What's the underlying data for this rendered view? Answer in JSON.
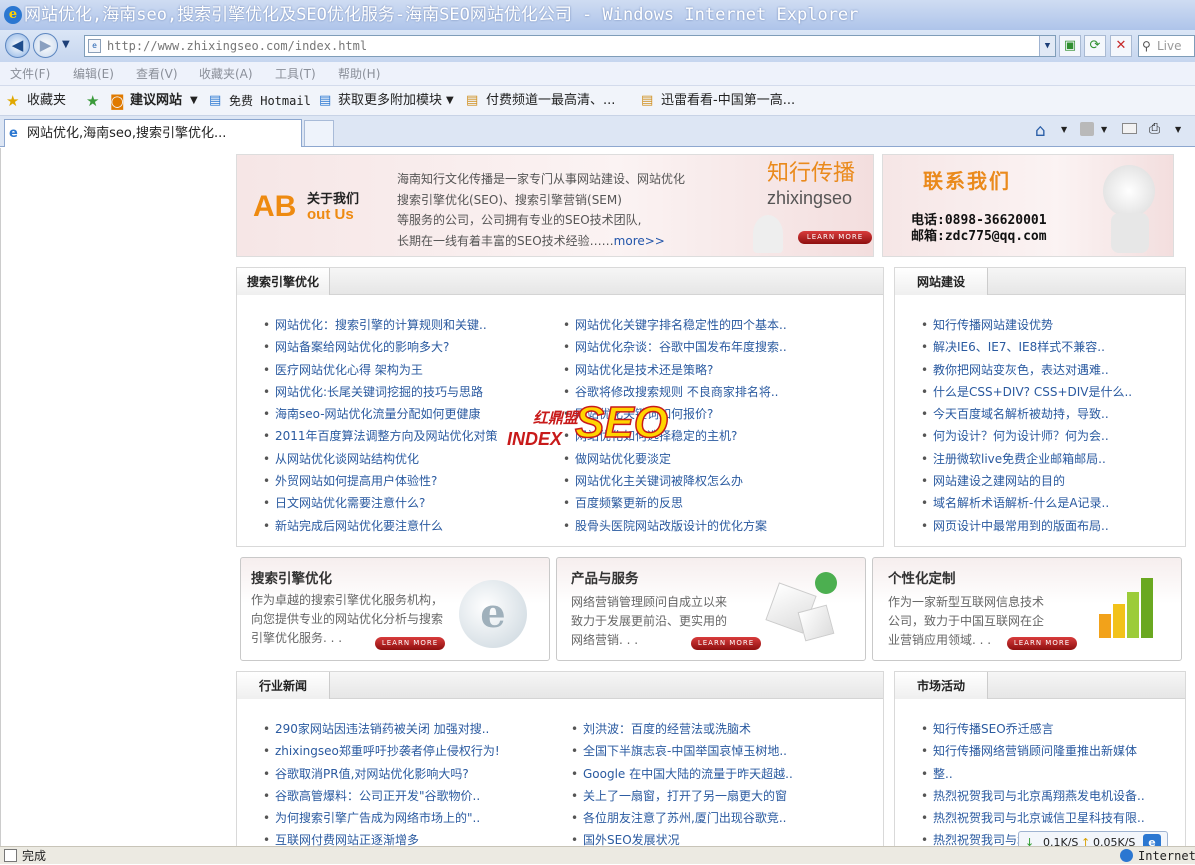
{
  "window": {
    "title": "网站优化,海南seo,搜索引擎优化及SEO优化服务-海南SEO网站优化公司 - Windows Internet Explorer"
  },
  "address": {
    "url": "http://www.zhixingseo.com/index.html",
    "search_placeholder": "Live"
  },
  "menu": {
    "items": [
      "文件(F)",
      "编辑(E)",
      "查看(V)",
      "收藏夹(A)",
      "工具(T)",
      "帮助(H)"
    ]
  },
  "favorites": {
    "label": "收藏夹",
    "items": [
      "建议网站",
      "免费 Hotmail",
      "获取更多附加模块",
      "付费频道一最高清、...",
      "迅雷看看-中国第一高..."
    ]
  },
  "tab": {
    "title": "网站优化,海南seo,搜索引擎优化..."
  },
  "about": {
    "badge_top": "关于我们",
    "badge_ab": "AB",
    "badge_out": "out Us",
    "text": [
      "海南知行文化传播是一家专门从事网站建设、网站优化",
      "搜索引擎优化(SEO)、搜索引擎营销(SEM)",
      "等服务的公司，公司拥有专业的SEO技术团队,",
      "长期在一线有着丰富的SEO技术经验……"
    ],
    "more": "more>>",
    "brand_cn": "知行传播",
    "brand_en": "zhixingseo",
    "learn": "LEARN MORE"
  },
  "contact": {
    "title": "联系我们",
    "phone": "电话:0898-36620001",
    "email": "邮箱:zdc775@qq.com"
  },
  "seo_panel": {
    "title": "搜索引擎优化",
    "left": [
      "网站优化：搜索引擎的计算规则和关键..",
      "网站备案给网站优化的影响多大?",
      "医疗网站优化心得 架构为王",
      "网站优化:长尾关键词挖掘的技巧与思路",
      "海南seo-网站优化流量分配如何更健康",
      "2011年百度算法调整方向及网站优化对策",
      "从网站优化谈网站结构优化",
      "外贸网站如何提高用户体验性?",
      "日文网站优化需要注意什么?",
      "新站完成后网站优化要注意什么"
    ],
    "right": [
      "网站优化关键字排名稳定性的四个基本..",
      "网站优化杂谈：谷歌中国发布年度搜索..",
      "网站优化是技术还是策略?",
      "谷歌将修改搜索规则 不良商家排名将..",
      "网站优化关键词如何报价?",
      "网站优化如何选择稳定的主机?",
      "做网站优化要淡定",
      "网站优化主关键词被降权怎么办",
      "百度频繁更新的反思",
      "股骨头医院网站改版设计的优化方案"
    ]
  },
  "web_panel": {
    "title": "网站建设",
    "items": [
      "知行传播网站建设优势",
      "解决IE6、IE7、IE8样式不兼容..",
      "教你把网站变灰色，表达对遇难..",
      "什么是CSS+DIV? CSS+DIV是什么..",
      "今天百度域名解析被劫持，导致..",
      "何为设计？何为设计师？何为会..",
      "注册微软live免费企业邮箱邮局..",
      "网站建设之建网站的目的",
      "域名解析术语解析-什么是A记录..",
      "网页设计中最常用到的版面布局.."
    ]
  },
  "watermark": {
    "cn": "红鼎盟",
    "index": "INDEX",
    "seo": "SEO"
  },
  "cards": [
    {
      "title": "搜索引擎优化",
      "desc": [
        "作为卓越的搜索引擎优化服务机构，",
        "向您提供专业的网站优化分析与搜索",
        "引擎优化服务. . ."
      ],
      "learn": "LEARN MORE"
    },
    {
      "title": "产品与服务",
      "desc": [
        "网络营销管理顾问自成立以来",
        "致力于发展更前沿、更实用的",
        "网络营销. . ."
      ],
      "learn": "LEARN MORE"
    },
    {
      "title": "个性化定制",
      "desc": [
        "作为一家新型互联网信息技术",
        "公司，致力于中国互联网在企",
        "业营销应用领域. . ."
      ],
      "learn": "LEARN MORE"
    }
  ],
  "news_panel": {
    "title": "行业新闻",
    "left": [
      "290家网站因违法销药被关闭 加强对搜..",
      "zhixingseo郑重呼吁抄袭者停止侵权行为!",
      "谷歌取消PR值,对网站优化影响大吗?",
      "谷歌高管爆料：公司正开发\"谷歌物价..",
      "为何搜索引擎广告成为网络市场上的\"..",
      "互联网付费网站正逐渐增多"
    ],
    "right": [
      "刘洪波：百度的经营法或洗脑术",
      "全国下半旗志哀-中国举国哀悼玉树地..",
      "Google 在中国大陆的流量于昨天超越..",
      "关上了一扇窗，打开了另一扇更大的窗",
      "各位朋友注意了苏州,厦门出现谷歌竞..",
      "国外SEO发展状况"
    ]
  },
  "market_panel": {
    "title": "市场活动",
    "items": [
      "知行传播SEO乔迁感言",
      "知行传播网络营销顾问隆重推出新媒体",
      "整..",
      "热烈祝贺我司与北京禹翔燕发电机设备..",
      "热烈祝贺我司与北京诚信卫星科技有限..",
      "热烈祝贺我司与北..."
    ]
  },
  "status": {
    "text": "完成",
    "down": "0.1K/S",
    "up": "0.05K/S",
    "zone": "Internet"
  },
  "colors": {
    "accent_orange": "#ea8a1c",
    "link_blue": "#2a5aa0",
    "learn_red": "#b81e1e"
  }
}
